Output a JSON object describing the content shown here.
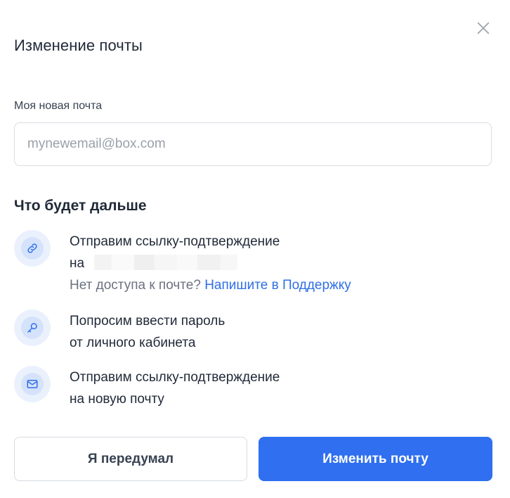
{
  "dialog": {
    "title": "Изменение почты",
    "close_icon": "close-icon"
  },
  "email_field": {
    "label": "Моя новая почта",
    "value": "",
    "placeholder": "mynewemail@box.com"
  },
  "steps_section": {
    "title": "Что будет дальше",
    "steps": [
      {
        "icon": "link-icon",
        "line1": "Отправим ссылку-подтверждение",
        "line2": "на",
        "note": "Нет доступа к почте?",
        "link": "Напишите в Поддержку"
      },
      {
        "icon": "key-icon",
        "line1": "Попросим ввести пароль",
        "line2": "от личного кабинета"
      },
      {
        "icon": "mail-icon",
        "line1": "Отправим ссылку-подтверждение",
        "line2": "на новую почту"
      }
    ]
  },
  "actions": {
    "cancel_label": "Я передумал",
    "submit_label": "Изменить почту"
  },
  "colors": {
    "accent": "#2f6ff0",
    "link": "#2f6fe4",
    "icon_bg": "#ebf1fc",
    "icon_inner": "#d5e2fb"
  }
}
